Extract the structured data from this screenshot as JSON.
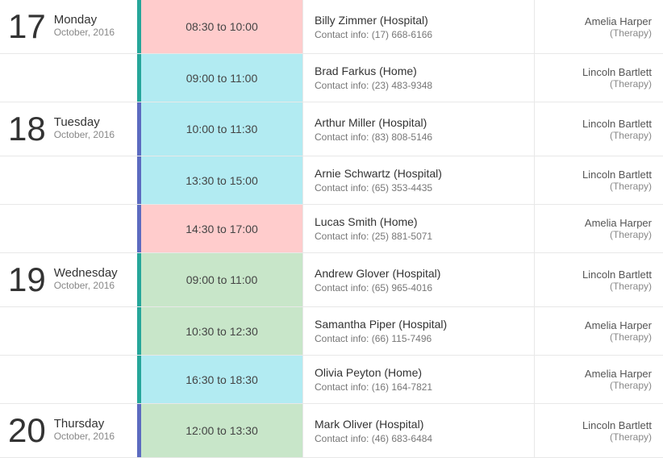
{
  "days": [
    {
      "dayNumber": "17",
      "dayName": "Monday",
      "monthYear": "October, 2016",
      "sidebarColor": "teal",
      "events": [
        {
          "time": "08:30 to 10:00",
          "timeColor": "pink",
          "clientName": "Billy Zimmer (Hospital)",
          "contactInfo": "Contact info: (17) 668-6166",
          "therapistName": "Amelia Harper",
          "therapistRole": "(Therapy)"
        },
        {
          "time": "09:00 to 11:00",
          "timeColor": "light-blue",
          "clientName": "Brad Farkus (Home)",
          "contactInfo": "Contact info: (23) 483-9348",
          "therapistName": "Lincoln Bartlett",
          "therapistRole": "(Therapy)"
        }
      ]
    },
    {
      "dayNumber": "18",
      "dayName": "Tuesday",
      "monthYear": "October, 2016",
      "sidebarColor": "blue",
      "events": [
        {
          "time": "10:00 to 11:30",
          "timeColor": "light-blue",
          "clientName": "Arthur Miller (Hospital)",
          "contactInfo": "Contact info: (83) 808-5146",
          "therapistName": "Lincoln Bartlett",
          "therapistRole": "(Therapy)"
        },
        {
          "time": "13:30 to 15:00",
          "timeColor": "light-blue",
          "clientName": "Arnie Schwartz (Hospital)",
          "contactInfo": "Contact info: (65) 353-4435",
          "therapistName": "Lincoln Bartlett",
          "therapistRole": "(Therapy)"
        },
        {
          "time": "14:30 to 17:00",
          "timeColor": "pink",
          "clientName": "Lucas Smith (Home)",
          "contactInfo": "Contact info: (25) 881-5071",
          "therapistName": "Amelia Harper",
          "therapistRole": "(Therapy)"
        }
      ]
    },
    {
      "dayNumber": "19",
      "dayName": "Wednesday",
      "monthYear": "October, 2016",
      "sidebarColor": "teal",
      "events": [
        {
          "time": "09:00 to 11:00",
          "timeColor": "green",
          "clientName": "Andrew Glover (Hospital)",
          "contactInfo": "Contact info: (65) 965-4016",
          "therapistName": "Lincoln Bartlett",
          "therapistRole": "(Therapy)"
        },
        {
          "time": "10:30 to 12:30",
          "timeColor": "green",
          "clientName": "Samantha Piper (Hospital)",
          "contactInfo": "Contact info: (66) 115-7496",
          "therapistName": "Amelia Harper",
          "therapistRole": "(Therapy)"
        },
        {
          "time": "16:30 to 18:30",
          "timeColor": "light-blue",
          "clientName": "Olivia Peyton (Home)",
          "contactInfo": "Contact info: (16) 164-7821",
          "therapistName": "Amelia Harper",
          "therapistRole": "(Therapy)"
        }
      ]
    },
    {
      "dayNumber": "20",
      "dayName": "Thursday",
      "monthYear": "October, 2016",
      "sidebarColor": "blue",
      "events": [
        {
          "time": "12:00 to 13:30",
          "timeColor": "green",
          "clientName": "Mark Oliver (Hospital)",
          "contactInfo": "Contact info: (46) 683-6484",
          "therapistName": "Lincoln Bartlett",
          "therapistRole": "(Therapy)"
        }
      ]
    }
  ]
}
